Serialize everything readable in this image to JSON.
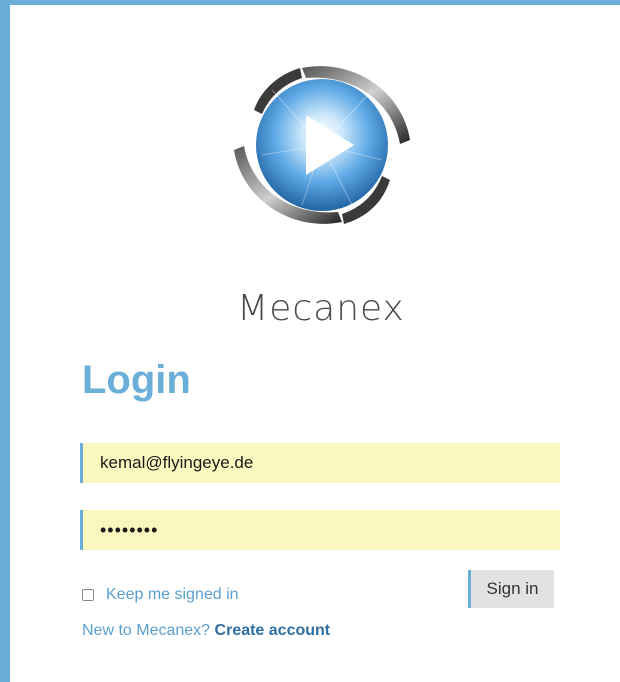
{
  "logo": {
    "brand_name": "Mecanex",
    "icon": "play-film-reel-icon"
  },
  "login": {
    "title": "Login",
    "email_value": "kemal@flyingeye.de",
    "password_value": "••••••••",
    "remember_label": "Keep me signed in",
    "remember_checked": false,
    "signin_label": "Sign in",
    "signup_prompt": "New to Mecanex?",
    "signup_link": "Create account"
  },
  "colors": {
    "accent": "#6bafd9",
    "field_background": "#fbf8bf",
    "link": "#2f6fa3",
    "button_background": "#e2e2e2"
  }
}
